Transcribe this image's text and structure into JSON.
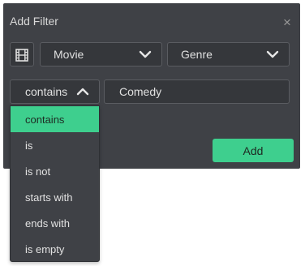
{
  "dialog": {
    "title": "Add Filter",
    "close_glyph": "×"
  },
  "filter": {
    "type_icon": "film-icon",
    "library": "Movie",
    "field": "Genre",
    "operator": "contains",
    "value": "Comedy"
  },
  "operator_options": [
    "contains",
    "is",
    "is not",
    "starts with",
    "ends with",
    "is empty"
  ],
  "selected_operator_index": 0,
  "add_label": "Add",
  "colors": {
    "dialog_bg": "#3f4146",
    "control_bg": "#35373b",
    "control_border": "#5a5c61",
    "accent": "#3ecf8e",
    "text": "#e0e0e0"
  }
}
